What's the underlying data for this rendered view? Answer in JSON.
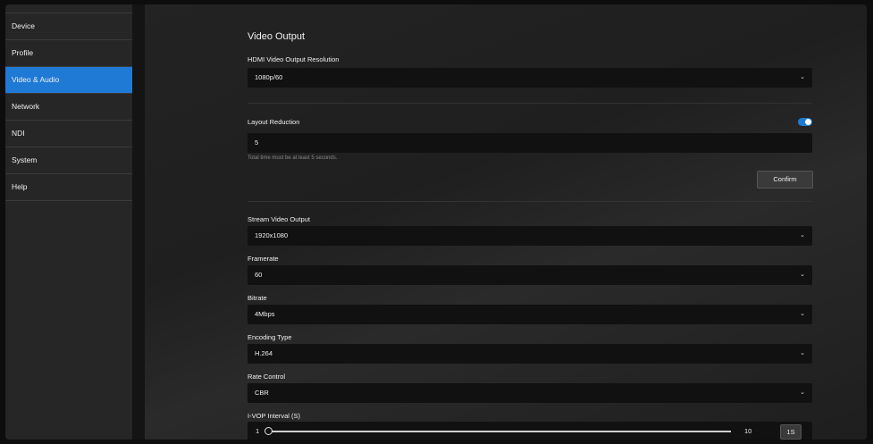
{
  "sidebar": {
    "items": [
      {
        "label": "Device"
      },
      {
        "label": "Profile"
      },
      {
        "label": "Video & Audio",
        "active": true
      },
      {
        "label": "Network"
      },
      {
        "label": "NDI"
      },
      {
        "label": "System"
      },
      {
        "label": "Help"
      }
    ]
  },
  "main": {
    "title": "Video Output",
    "hdmi": {
      "label": "HDMI Video Output Resolution",
      "value": "1080p/60"
    },
    "layout_reduction": {
      "label": "Layout Reduction",
      "toggle_on": true,
      "value": "5",
      "hint": "Total time must be at least 5 seconds.",
      "confirm_label": "Confirm"
    },
    "stream": {
      "label": "Stream Video Output",
      "value": "1920x1080"
    },
    "framerate": {
      "label": "Framerate",
      "value": "60"
    },
    "bitrate": {
      "label": "Bitrate",
      "value": "4Mbps"
    },
    "encoding": {
      "label": "Encoding Type",
      "value": "H.264"
    },
    "rate_control": {
      "label": "Rate Control",
      "value": "CBR"
    },
    "ivop": {
      "label": "I-VOP Interval (S)",
      "min": "1",
      "max": "10",
      "unit_button": "1S"
    }
  },
  "colors": {
    "accent": "#1f7ad6",
    "background": "#1a1a1a",
    "sidebar": "#262626"
  },
  "icons": {
    "dropdown": "chevron-down-icon"
  }
}
